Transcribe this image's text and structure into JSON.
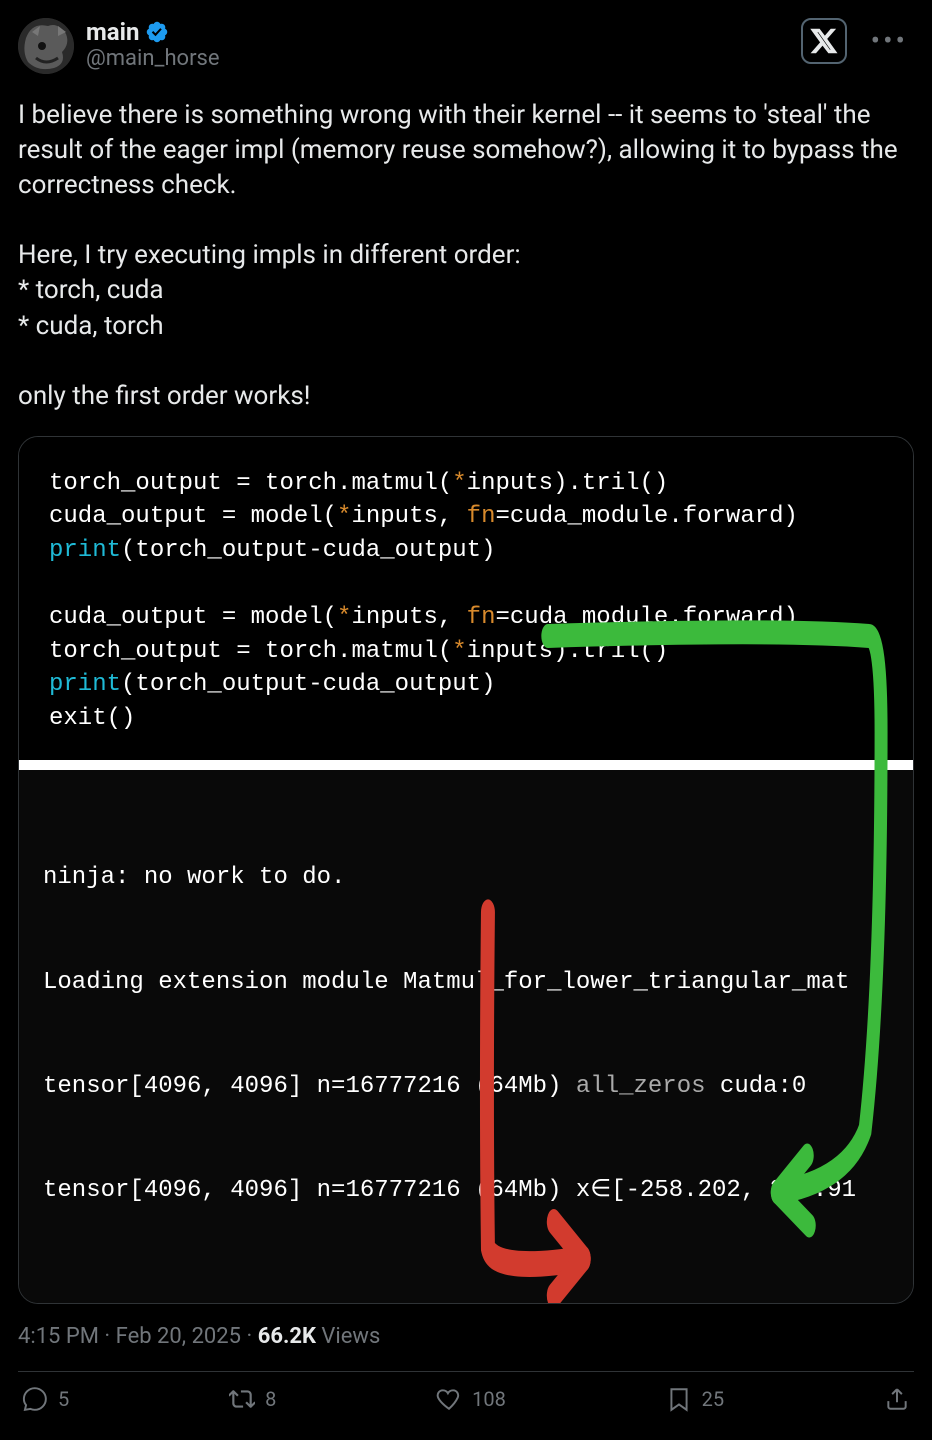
{
  "user": {
    "display_name": "main",
    "handle": "@main_horse"
  },
  "post_text": "I believe there is something wrong with their kernel -- it seems to 'steal' the result of the eager impl (memory reuse somehow?), allowing it to bypass the correctness check.\n\nHere, I try executing impls in different order:\n* torch, cuda\n* cuda, torch\n\nonly the first order works!",
  "code": {
    "block1": {
      "l1a": "torch_output = torch.matmul(",
      "l1b": "*",
      "l1c": "inputs).tril()",
      "l2a": "cuda_output = model(",
      "l2b": "*",
      "l2c": "inputs, ",
      "l2d": "fn",
      "l2e": "=cuda_module.forward)",
      "l3a": "print",
      "l3b": "(torch_output-cuda_output)"
    },
    "block2": {
      "l1a": "cuda_output = model(",
      "l1b": "*",
      "l1c": "inputs, ",
      "l1d": "fn",
      "l1e": "=cuda_module.forward)",
      "l2a": "torch_output = torch.matmul(",
      "l2b": "*",
      "l2c": "inputs).tril()",
      "l3a": "print",
      "l3b": "(torch_output-cuda_output)",
      "l4": "exit()"
    },
    "output": {
      "l1": "ninja: no work to do.",
      "l2": "Loading extension module Matmul_for_lower_triangular_mat",
      "l3a": "tensor[4096, 4096] n=16777216 (64Mb)",
      "l3b": " all_zeros",
      "l3c": " cuda:0",
      "l4a": "tensor[4096, 4096] n=16777216 (64Mb) ",
      "l4b": "x∈[-258.202, 286.91"
    }
  },
  "meta": {
    "time": "4:15 PM",
    "date": "Feb 20, 2025",
    "views_n": "66.2K",
    "views_label": "Views"
  },
  "actions": {
    "replies": "5",
    "retweets": "8",
    "likes": "108",
    "bookmarks": "25"
  }
}
